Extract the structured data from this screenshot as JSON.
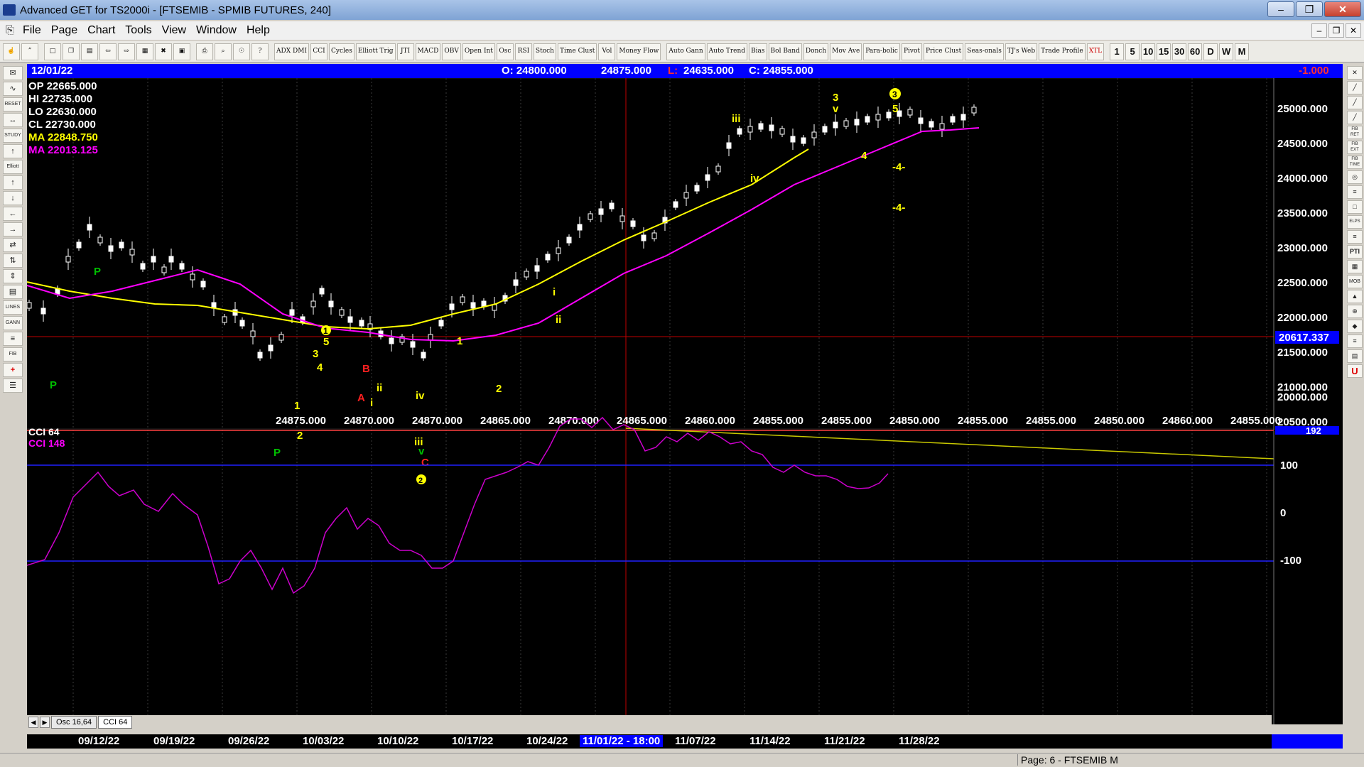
{
  "window": {
    "title": "Advanced GET for TS2000i - [FTSEMIB - SPMIB FUTURES, 240]",
    "min": "–",
    "max": "❐",
    "close": "✕"
  },
  "menu": [
    "File",
    "Page",
    "Chart",
    "Tools",
    "View",
    "Window",
    "Help"
  ],
  "toolbar": {
    "tools": [
      "ADX DMI",
      "CCI",
      "Cycles",
      "Elliott Trig",
      "JTI",
      "MACD",
      "OBV",
      "Open Int",
      "Osc",
      "RSI",
      "Stoch",
      "Time Clust",
      "Vol",
      "Money Flow",
      "Auto Gann",
      "Auto Trend",
      "Bias",
      "Bol Band",
      "Donch",
      "Mov Ave",
      "Para-bolic",
      "Pivot",
      "Price Clust",
      "Seas-onals",
      "TJ's Web",
      "Trade Profile",
      "XTL"
    ],
    "periods": [
      "1",
      "5",
      "10",
      "15",
      "30",
      "60",
      "D",
      "W",
      "M"
    ]
  },
  "left_tools": [
    "✉",
    "∿",
    "RESET",
    "↔",
    "STUDY",
    "↑",
    "Elliott",
    "↑",
    "↓",
    "←",
    "→",
    "⇄",
    "⇅",
    "⇕",
    "▤",
    "LINES",
    "GANN",
    "≡",
    "FIB",
    "+",
    "☰"
  ],
  "right_tools": [
    "✕",
    "╱",
    "╱",
    "╱",
    "FIB RET",
    "FIB EXT",
    "FIB TIME",
    "◎",
    "≡",
    "□",
    "ELPS",
    "≡",
    "PTI",
    "▦",
    "MOB",
    "▲",
    "⊕",
    "◆",
    "≡",
    "▤",
    "U"
  ],
  "info_bar": {
    "date": "12/01/22",
    "open": "O: 24800.000",
    "high": "24875.000",
    "low_label": "L:",
    "low": "24635.000",
    "close": "C: 24855.000",
    "change": "-1.000"
  },
  "legend": {
    "op": "OP  22665.000",
    "hi": "HI   22735.000",
    "lo": "LO  22630.000",
    "cl": "CL  22730.000",
    "ma1": "MA  22848.750",
    "ma2": "MA  22013.125"
  },
  "cci_legend": {
    "cci1": "CCI  64",
    "cci2": "CCI  148"
  },
  "price_axis": {
    "labels": [
      "25000.000",
      "24500.000",
      "24000.000",
      "23500.000",
      "23000.000",
      "22500.000",
      "22000.000",
      "21500.000",
      "21000.000",
      "20500.000",
      "20000.000"
    ],
    "current": "20617.337"
  },
  "cci_axis": {
    "labels": [
      "192",
      "100",
      "0",
      "-100"
    ]
  },
  "bottom_values": [
    "24875.000",
    "24870.000",
    "24870.000",
    "24865.000",
    "24870.000",
    "24865.000",
    "24860.000",
    "24855.000",
    "24855.000",
    "24850.000",
    "24855.000",
    "24855.000",
    "24850.000",
    "24860.000",
    "24855.000"
  ],
  "dates": [
    "09/12/22",
    "09/19/22",
    "09/26/22",
    "10/03/22",
    "10/10/22",
    "10/17/22",
    "10/24/22",
    "11/01/22 - 18:00",
    "11/07/22",
    "11/14/22",
    "11/21/22",
    "11/28/22"
  ],
  "tabs": [
    "Osc 16,64",
    "CCI 64"
  ],
  "wave_labels": {
    "p1": "P",
    "p2": "P",
    "p3": "P",
    "w1a": "1",
    "w2a": "2",
    "w3a": "3",
    "w4a": "4",
    "w5a": "5",
    "w1c": "1",
    "a": "A",
    "b": "B",
    "c": "C",
    "i1": "i",
    "ii1": "ii",
    "iii1": "iii",
    "iv1": "iv",
    "v1": "v",
    "w1b": "1",
    "w2b": "2",
    "i2": "i",
    "ii2": "ii",
    "iii2": "iii",
    "iv2": "iv",
    "w3b": "3",
    "v2": "v",
    "w4b": "4",
    "w5b": "5",
    "w3c": "3",
    "w2c": "2",
    "t1": "-4-",
    "t2": "-4-"
  },
  "status": {
    "page": "Page: 6 - FTSEMIB M"
  },
  "colors": {
    "yellow": "#ffff00",
    "magenta": "#ff00ff",
    "green": "#00c000",
    "red": "#ff0000",
    "blue": "#0000ff"
  }
}
